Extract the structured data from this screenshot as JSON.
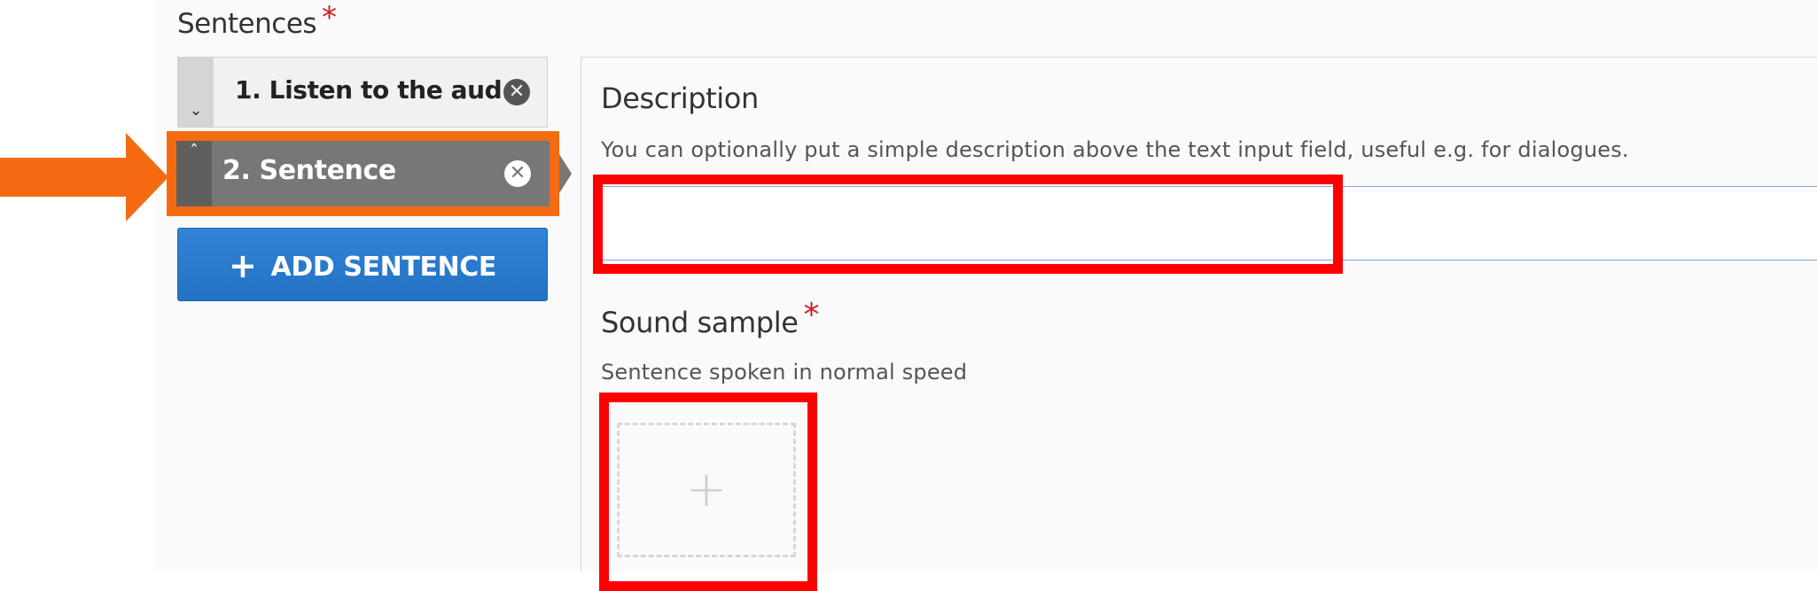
{
  "sentences": {
    "title": "Sentences",
    "required_mark": "*",
    "items": [
      {
        "label": "1. Listen to the aud...",
        "handle": "⌄",
        "remove": "✕"
      },
      {
        "label": "2. Sentence",
        "handle": "ˆ",
        "remove": "✕"
      }
    ],
    "add_button": {
      "icon": "+",
      "label": "ADD SENTENCE"
    }
  },
  "description": {
    "label": "Description",
    "help": "You can optionally put a simple description above the text input field, useful e.g. for dialogues.",
    "value": ""
  },
  "sound_sample": {
    "label": "Sound sample",
    "required_mark": "*",
    "help": "Sentence spoken in normal speed",
    "upload_icon": "+"
  },
  "annotations": {
    "arrow_color": "#f46b12",
    "highlight_color": "#ff0000"
  },
  "colors": {
    "primary_button": "#2a7bcd",
    "selected_item": "#777777",
    "required": "#cc1f1f"
  }
}
